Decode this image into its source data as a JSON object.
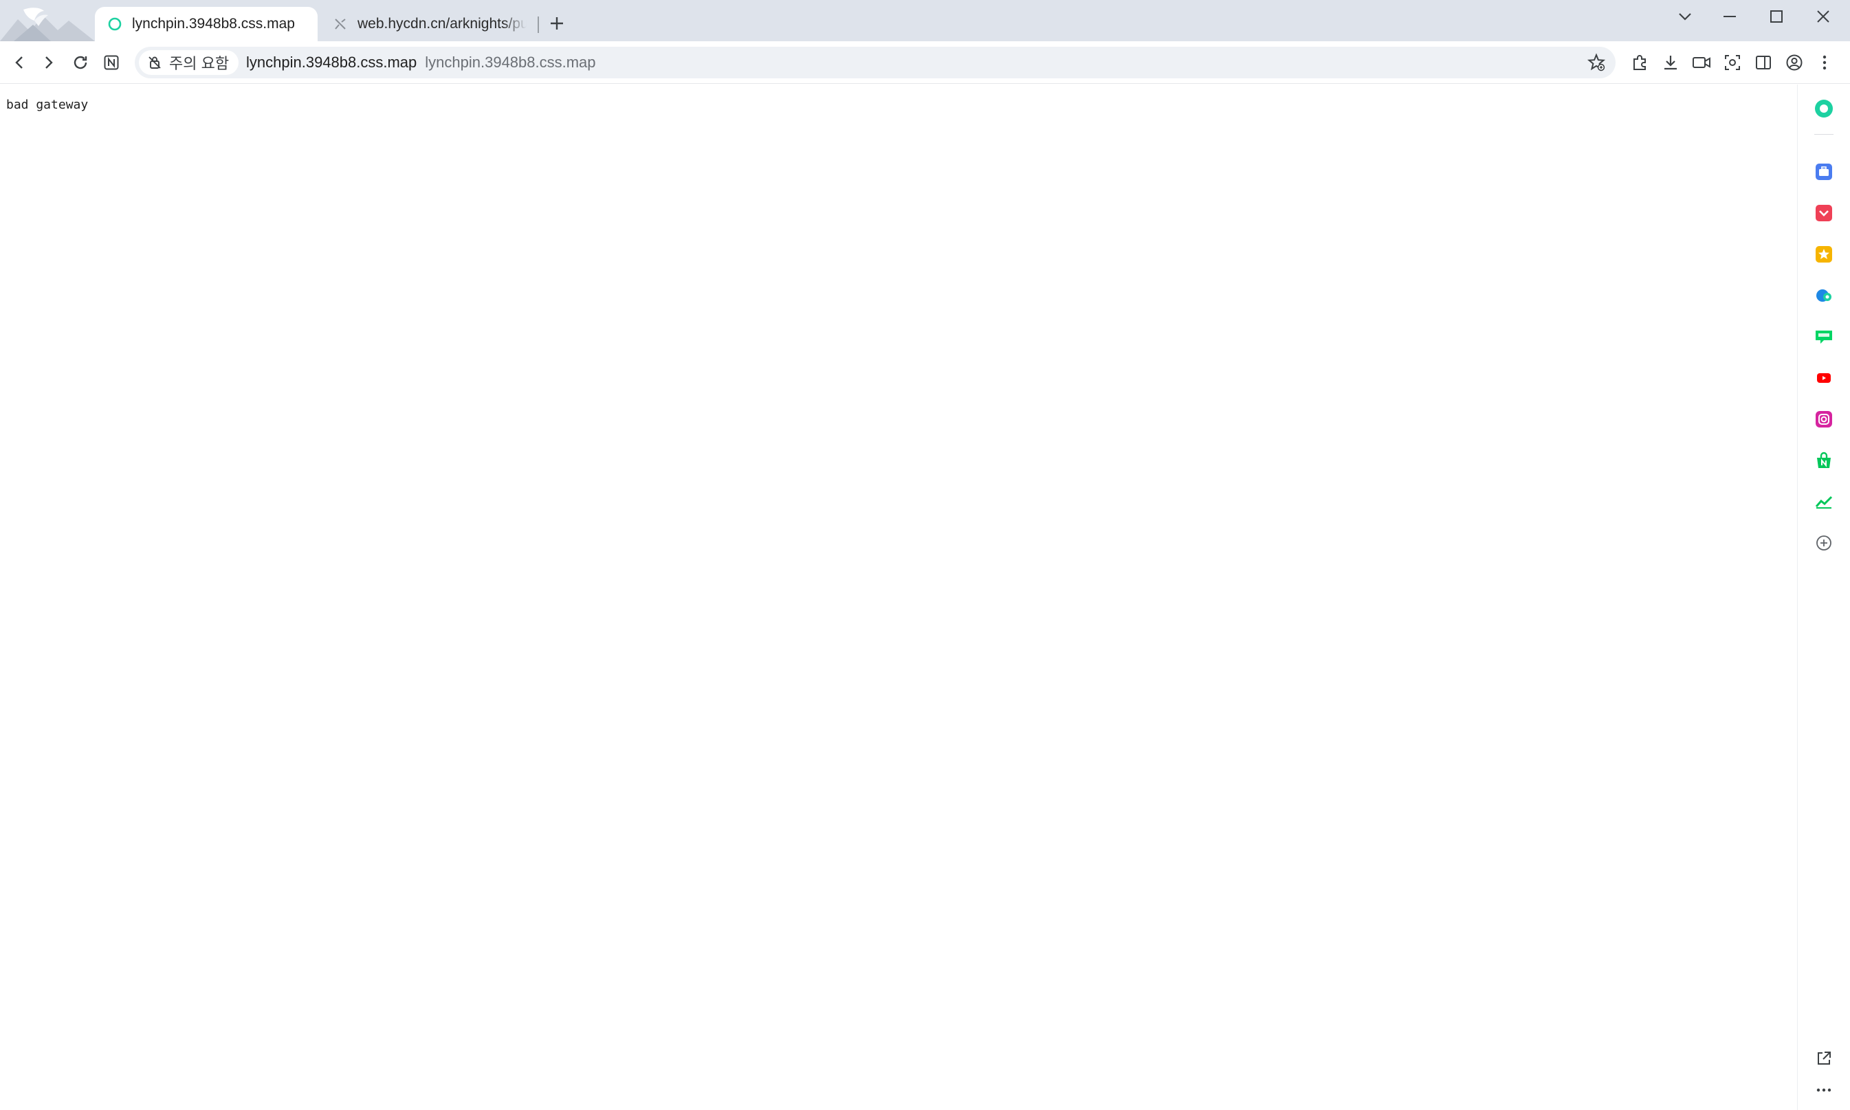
{
  "browser": {
    "tabs": [
      {
        "title": "lynchpin.3948b8.css.map",
        "active": true,
        "favicon": "ring-icon"
      },
      {
        "title": "web.hycdn.cn/arknights/puzzle",
        "active": false,
        "favicon": "broken-image-icon"
      }
    ],
    "new_tab_icon": "plus-icon",
    "window_controls": [
      "tab-search-chevron-icon",
      "minimize-icon",
      "maximize-icon",
      "close-icon"
    ],
    "toolbar": {
      "nav": [
        "back-icon",
        "forward-icon",
        "reload-icon",
        "notion-icon"
      ],
      "security_chip": "주의 요함",
      "url_host": "lynchpin.3948b8.css.map",
      "url_path": "lynchpin.3948b8.css.map",
      "right_icons": [
        "bookmark-star-icon",
        "extensions-icon",
        "download-icon",
        "video-icon",
        "screenshot-icon",
        "sidebar-icon",
        "profile-icon",
        "menu-icon"
      ]
    }
  },
  "page": {
    "body_text": "bad gateway"
  },
  "sidepanel": {
    "items": [
      "whale-assistant-icon",
      "briefcase-icon",
      "pocket-icon",
      "favorites-star-icon",
      "translate-icon",
      "webtoon-icon",
      "youtube-icon",
      "instagram-icon",
      "naver-shopping-icon",
      "stock-chart-icon",
      "add-icon"
    ],
    "bottom": [
      "open-external-icon",
      "more-icon"
    ]
  },
  "colors": {
    "tabstrip_bg": "#dee3eb",
    "accent_green": "#1dd1a1",
    "omnibox_bg": "#eef1f5"
  }
}
